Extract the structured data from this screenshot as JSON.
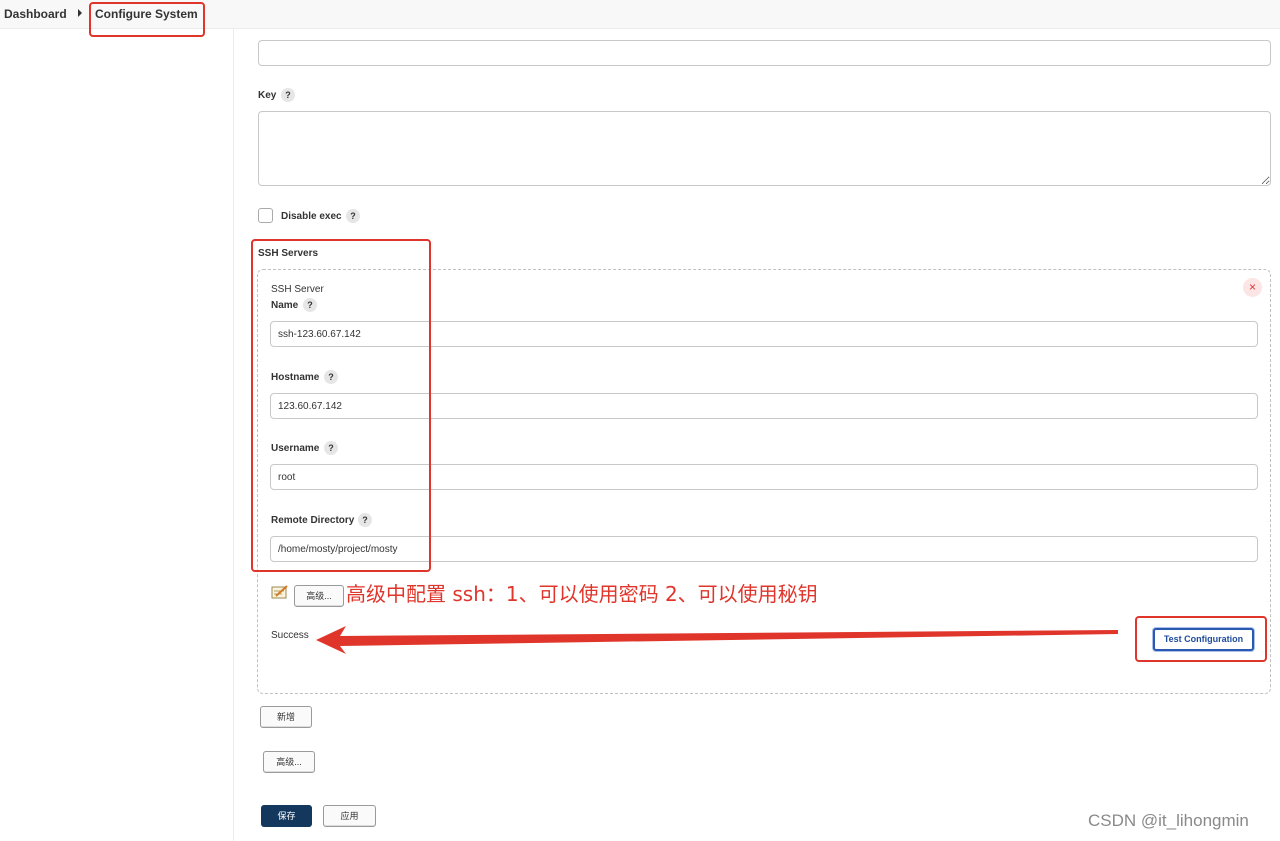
{
  "breadcrumb": {
    "dashboard": "Dashboard",
    "current": "Configure System"
  },
  "form": {
    "key_label": "Key",
    "help_glyph": "?",
    "disable_exec_label": "Disable exec",
    "ssh_servers_label": "SSH Servers"
  },
  "ssh_server": {
    "section_title": "SSH Server",
    "delete_glyph": "×",
    "name_label": "Name",
    "name_value": "ssh-123.60.67.142",
    "hostname_label": "Hostname",
    "hostname_value": "123.60.67.142",
    "username_label": "Username",
    "username_value": "root",
    "remote_dir_label": "Remote Directory",
    "remote_dir_value": "/home/mosty/project/mosty",
    "advanced_label": "高级...",
    "status_text": "Success",
    "test_button_label": "Test Configuration"
  },
  "footer": {
    "add_label": "新增",
    "advanced_label": "高级...",
    "save_label": "保存",
    "apply_label": "应用"
  },
  "annotation": {
    "text": "高级中配置 ssh：1、可以使用密码 2、可以使用秘钥",
    "color": "#e0352b"
  },
  "watermark": "CSDN @it_lihongmin",
  "colors": {
    "primary": "#14385d",
    "annotation_red": "#e0352b",
    "test_button_blue": "#2a5ab0"
  }
}
